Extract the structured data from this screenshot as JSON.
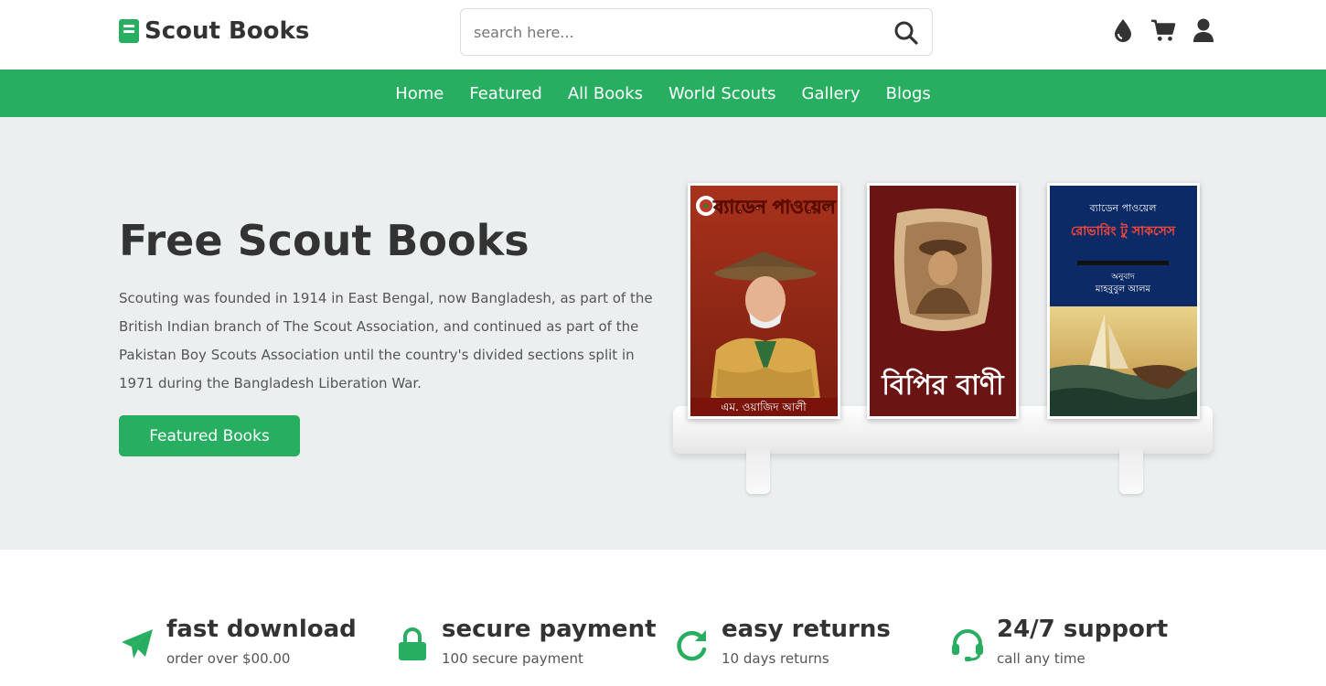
{
  "brand": {
    "name": "Scout Books",
    "accent": "#27ae60"
  },
  "search": {
    "placeholder": "search here..."
  },
  "header_icons": [
    "drop-icon",
    "cart-icon",
    "user-icon"
  ],
  "nav": [
    "Home",
    "Featured",
    "All Books",
    "World Scouts",
    "Gallery",
    "Blogs"
  ],
  "hero": {
    "title": "Free Scout Books",
    "text": "Scouting was founded in 1914 in East Bengal, now Bangladesh, as part of the British Indian branch of The Scout Association, and continued as part of the Pakistan Boy Scouts Association until the country's divided sections split in 1971 during the Bangladesh Liberation War.",
    "button": "Featured Books",
    "books": [
      {
        "title": "ব্যাডেন পাওয়েল",
        "author": "এম. ওয়াজিদ আলী"
      },
      {
        "title": "বিপির বাণী"
      },
      {
        "author": "ব্যাডেন পাওয়েল",
        "title": "রোভারিং টু সাকসেস",
        "translator_label": "অনুবাদ",
        "translator": "মাহবুবুল আলম"
      }
    ]
  },
  "features": [
    {
      "icon": "paper-plane-icon",
      "title": "fast download",
      "subtitle": "order over $00.00"
    },
    {
      "icon": "lock-icon",
      "title": "secure payment",
      "subtitle": "100 secure payment"
    },
    {
      "icon": "redo-icon",
      "title": "easy returns",
      "subtitle": "10 days returns"
    },
    {
      "icon": "headset-icon",
      "title": "24/7 support",
      "subtitle": "call any time"
    }
  ]
}
